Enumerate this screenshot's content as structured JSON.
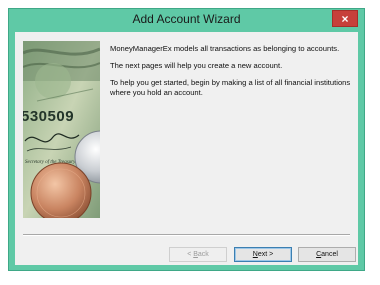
{
  "window": {
    "title": "Add Account Wizard",
    "close_label": "×"
  },
  "intro": {
    "line1": "MoneyManagerEx models all transactions as belonging to accounts.",
    "line2": "The next pages will help you create a new account.",
    "line3": "To help you get started, begin by making a list of all financial institutions where you hold an account."
  },
  "buttons": {
    "back": {
      "pre": "< ",
      "acc": "B",
      "post": "ack"
    },
    "next": {
      "acc": "N",
      "post": "ext >"
    },
    "cancel": {
      "acc": "C",
      "post": "ancel"
    }
  },
  "image": {
    "banknote_text": "530509"
  },
  "colors": {
    "title_bar": "#5fc9a6",
    "close_button": "#c7403a",
    "client_bg": "#f0f0f0"
  }
}
